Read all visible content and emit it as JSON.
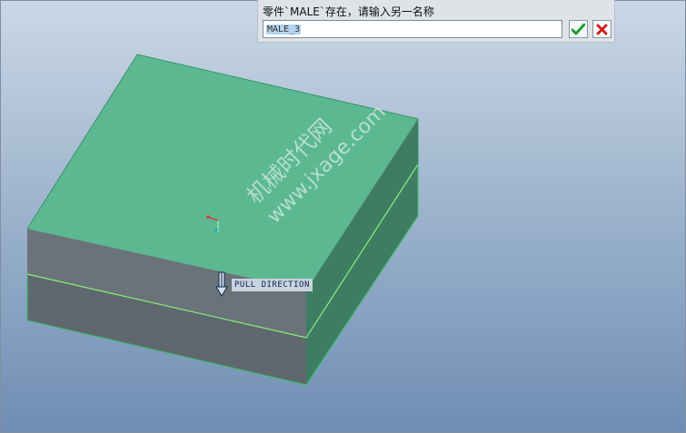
{
  "prompt": {
    "message": "零件`MALE`存在，请输入另一名称",
    "input_value": "MALE_3"
  },
  "buttons": {
    "ok_icon": "check-icon",
    "cancel_icon": "close-icon"
  },
  "viewport": {
    "pull_direction_label": "PULL DIRECTION",
    "watermark_cn": "机械时代网",
    "watermark_url": "www.jxage.com"
  },
  "colors": {
    "top_face": "#5cb890",
    "front_face": "#5f686f",
    "side_face": "#3f7d63",
    "edge_highlight": "#86f07a"
  }
}
